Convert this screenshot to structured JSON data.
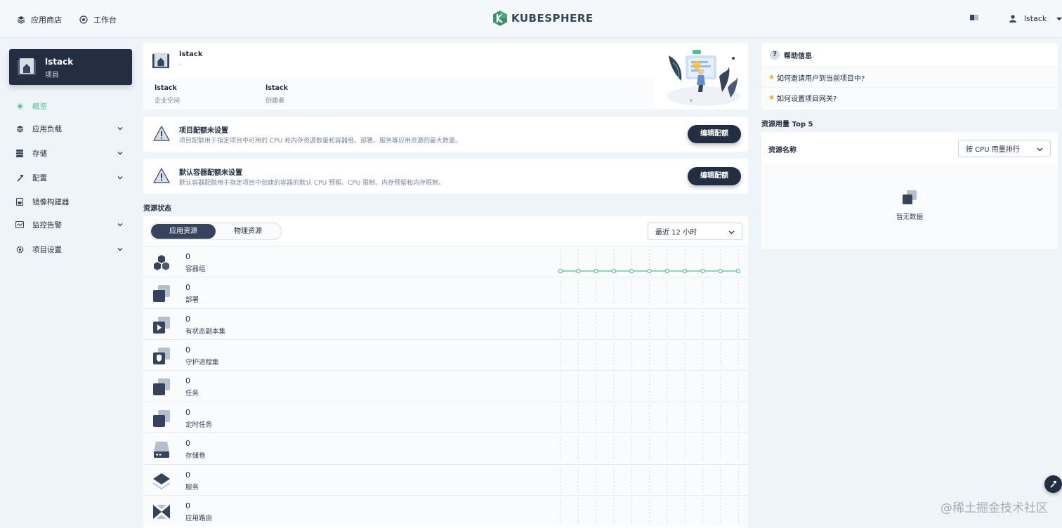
{
  "header": {
    "app_store": "应用商店",
    "workbench": "工作台",
    "logo": "KUBESPHERE",
    "user": "lstack"
  },
  "sidebar": {
    "project_name": "lstack",
    "project_type": "项目",
    "items": [
      {
        "label": "概览",
        "icon": "overview-icon",
        "active": true
      },
      {
        "label": "应用负载",
        "icon": "app-workload-icon",
        "expandable": true
      },
      {
        "label": "存储",
        "icon": "storage-icon",
        "expandable": true
      },
      {
        "label": "配置",
        "icon": "config-icon",
        "expandable": true
      },
      {
        "label": "镜像构建器",
        "icon": "image-builder-icon"
      },
      {
        "label": "监控告警",
        "icon": "monitoring-icon",
        "expandable": true
      },
      {
        "label": "项目设置",
        "icon": "settings-icon",
        "expandable": true
      }
    ]
  },
  "project_info": {
    "name": "lstack",
    "description": "-",
    "workspace": "lstack",
    "workspace_label": "企业空间",
    "creator": "lstack",
    "creator_label": "创建者"
  },
  "quota": {
    "title": "项目配额未设置",
    "desc": "项目配额用于指定项目中可用的 CPU 和内存资源数量和容器组、部署、服务等应用资源的最大数量。",
    "button": "编辑配额"
  },
  "default_quota": {
    "title": "默认容器配额未设置",
    "desc": "默认容器配额用于指定项目中创建的容器的默认 CPU 预留、CPU 限制、内存预留和内存限制。",
    "button": "编辑配额"
  },
  "resource_status": {
    "title": "资源状态",
    "tabs": [
      "应用资源",
      "物理资源"
    ],
    "time_range": "最近 12 小时",
    "rows": [
      {
        "value": "0",
        "label": "容器组",
        "icon": "pods-icon"
      },
      {
        "value": "0",
        "label": "部署",
        "icon": "deployment-icon"
      },
      {
        "value": "0",
        "label": "有状态副本集",
        "icon": "statefulset-icon"
      },
      {
        "value": "0",
        "label": "守护进程集",
        "icon": "daemonset-icon"
      },
      {
        "value": "0",
        "label": "任务",
        "icon": "job-icon"
      },
      {
        "value": "0",
        "label": "定时任务",
        "icon": "cronjob-icon"
      },
      {
        "value": "0",
        "label": "存储卷",
        "icon": "volume-icon"
      },
      {
        "value": "0",
        "label": "服务",
        "icon": "service-icon"
      },
      {
        "value": "0",
        "label": "应用路由",
        "icon": "ingress-icon"
      }
    ]
  },
  "help": {
    "title": "帮助信息",
    "items": [
      "如何邀请用户到当前项目中?",
      "如何设置项目网关?"
    ]
  },
  "top5": {
    "title": "资源用量 Top 5",
    "column": "资源名称",
    "sort": "按 CPU 用量排行",
    "empty": "暂无数据"
  },
  "watermark": "@稀土掘金技术社区",
  "colors": {
    "accent": "#55bc8a",
    "dark": "#242e42",
    "page_bg": "#eff4f9"
  }
}
